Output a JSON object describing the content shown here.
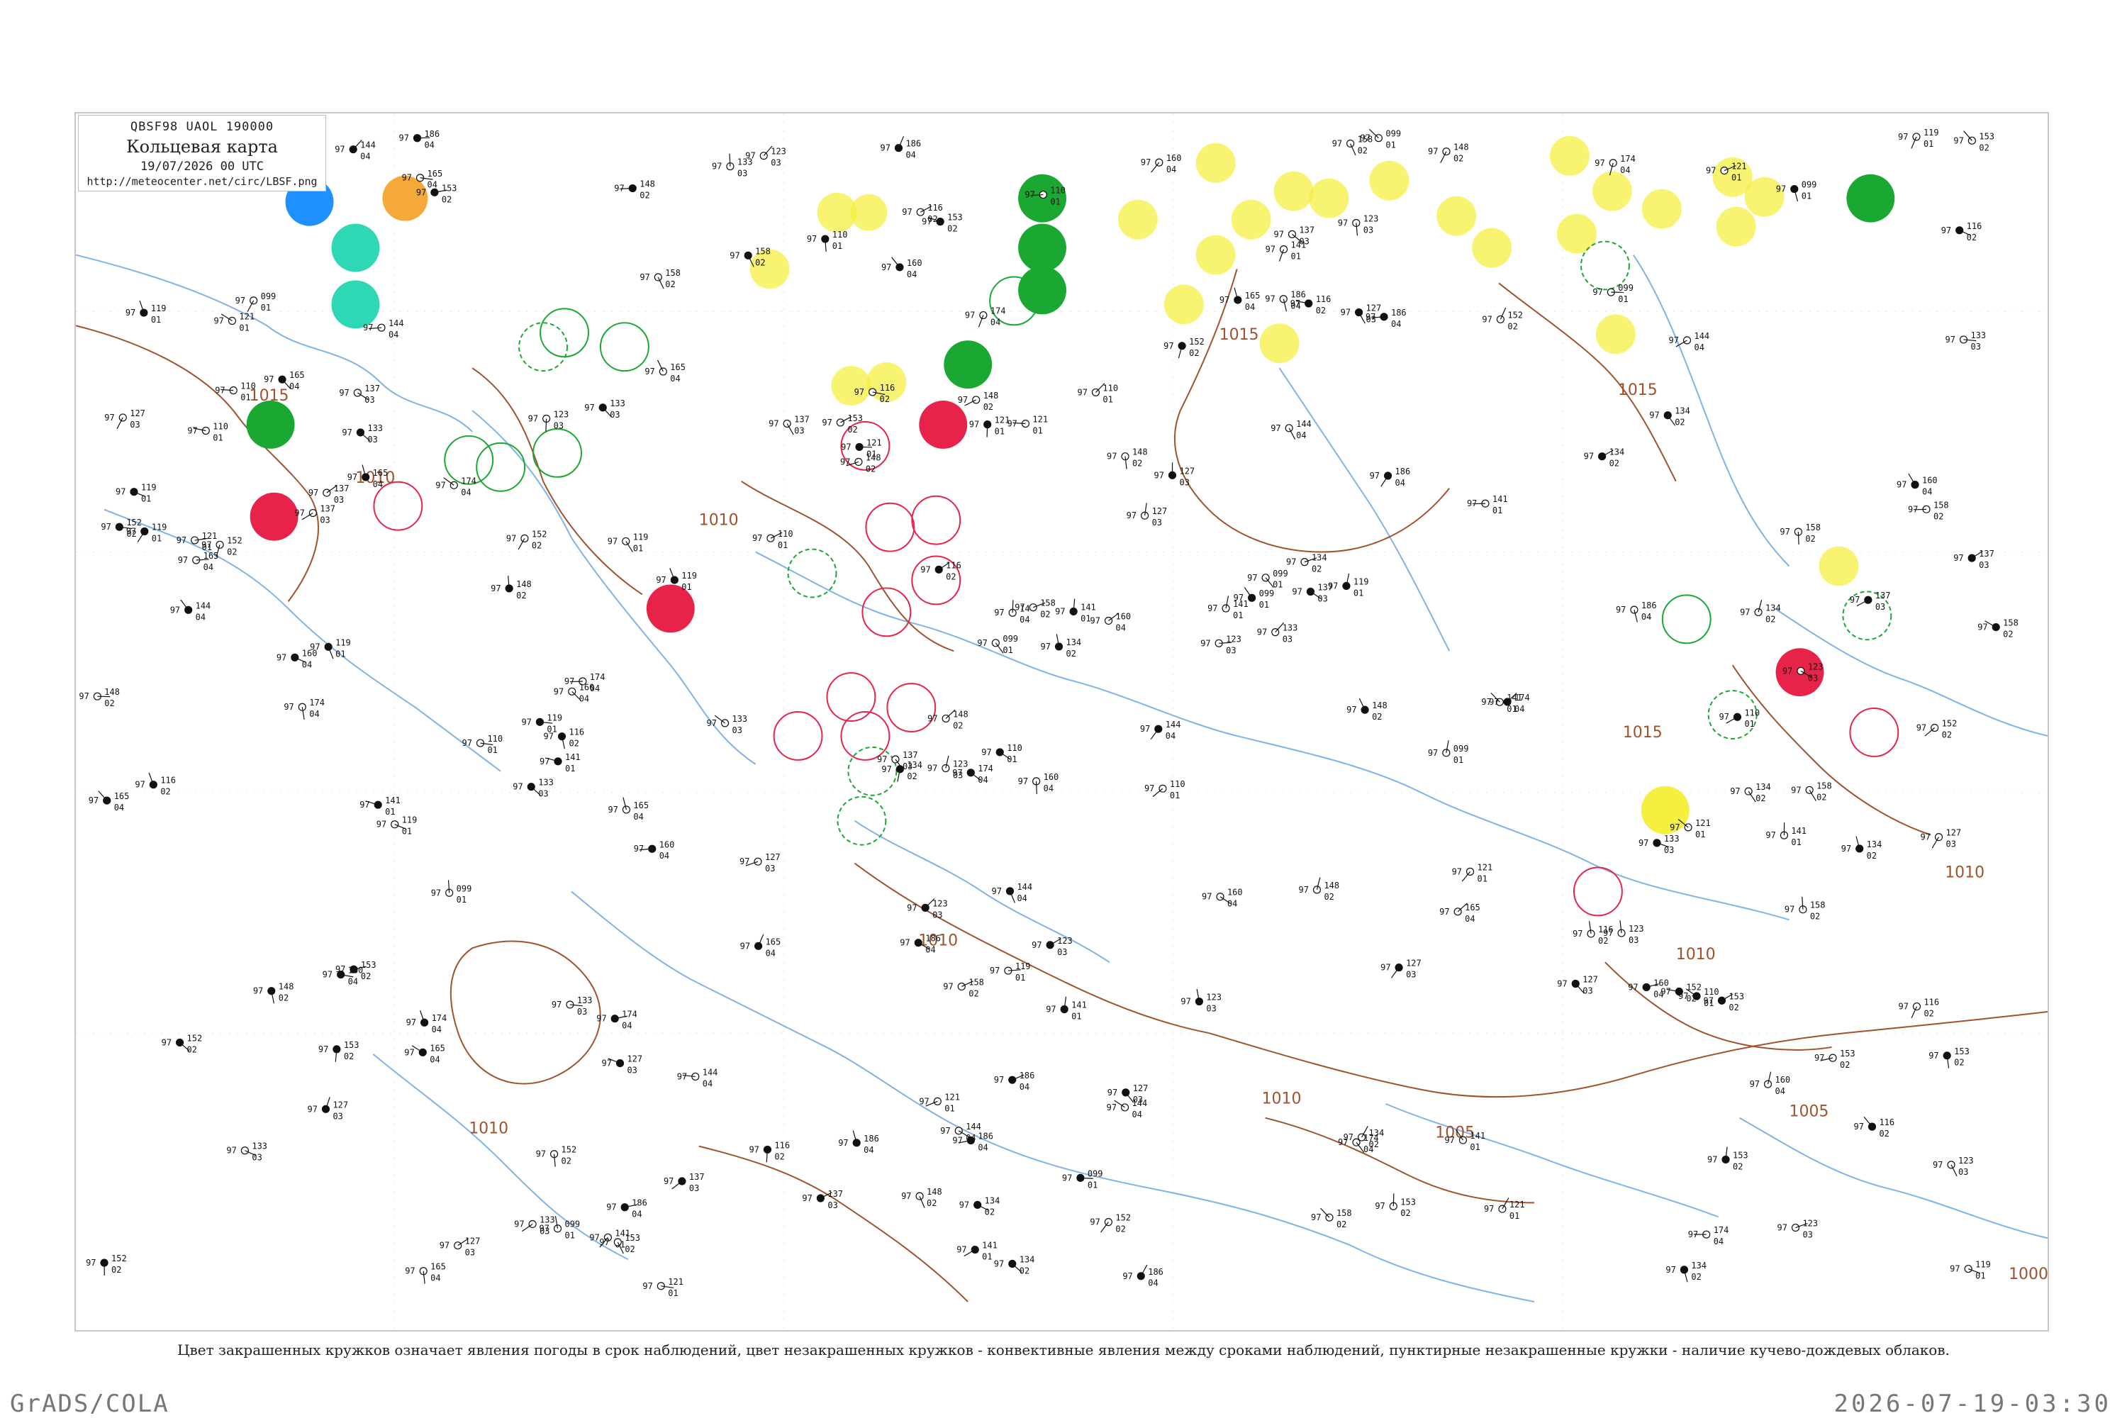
{
  "header": {
    "bulletin_code": "QBSF98  UAOL  190000",
    "title": "Кольцевая карта",
    "datetime": "19/07/2026 00 UTC",
    "url": "http://meteocenter.net/circ/LBSF.png"
  },
  "caption": "Цвет закрашенных кружков означает явления погоды в срок наблюдений, цвет незакрашенных кружков - конвективные явления между сроками наблюдений, пунктирные незакрашенные кружки - наличие кучево-дождевых облаков.",
  "footer": {
    "left": "GrADS/COLA",
    "right": "2026-07-19-03:30"
  },
  "colors": {
    "isobar": "#a0522d",
    "water": "#7fb3e8",
    "thunderstorm": "#e8234a",
    "rain": "#1aa832",
    "fog": "#f5ef40",
    "blue_phenomenon": "#1e90ff",
    "orange_phenomenon": "#f4a93a",
    "teal_phenomenon": "#2ed8b4",
    "frame": "#c8c8c8"
  },
  "isobars": [
    {
      "label": "1015"
    },
    {
      "label": "1010"
    },
    {
      "label": "1005"
    },
    {
      "label": "1000"
    }
  ],
  "stations": [
    {
      "p": "160",
      "t": "97",
      "d": "04"
    },
    {
      "p": "148",
      "t": "97",
      "d": "02"
    },
    {
      "p": "141",
      "t": "97",
      "d": "01"
    },
    {
      "p": "123",
      "t": "97",
      "d": "03"
    },
    {
      "p": "186",
      "t": "97",
      "d": "04"
    },
    {
      "p": "153",
      "t": "97",
      "d": "02"
    },
    {
      "p": "119",
      "t": "97",
      "d": "01"
    },
    {
      "p": "134",
      "t": "97",
      "d": "02"
    },
    {
      "p": "165",
      "t": "97",
      "d": "04"
    },
    {
      "p": "127",
      "t": "97",
      "d": "03"
    },
    {
      "p": "110",
      "t": "97",
      "d": "01"
    },
    {
      "p": "152",
      "t": "97",
      "d": "02"
    },
    {
      "p": "099",
      "t": "97",
      "d": "01"
    },
    {
      "p": "137",
      "t": "97",
      "d": "03"
    },
    {
      "p": "144",
      "t": "97",
      "d": "04"
    },
    {
      "p": "158",
      "t": "97",
      "d": "02"
    },
    {
      "p": "121",
      "t": "97",
      "d": "01"
    },
    {
      "p": "133",
      "t": "97",
      "d": "03"
    },
    {
      "p": "174",
      "t": "97",
      "d": "04"
    },
    {
      "p": "116",
      "t": "97",
      "d": "02"
    }
  ]
}
